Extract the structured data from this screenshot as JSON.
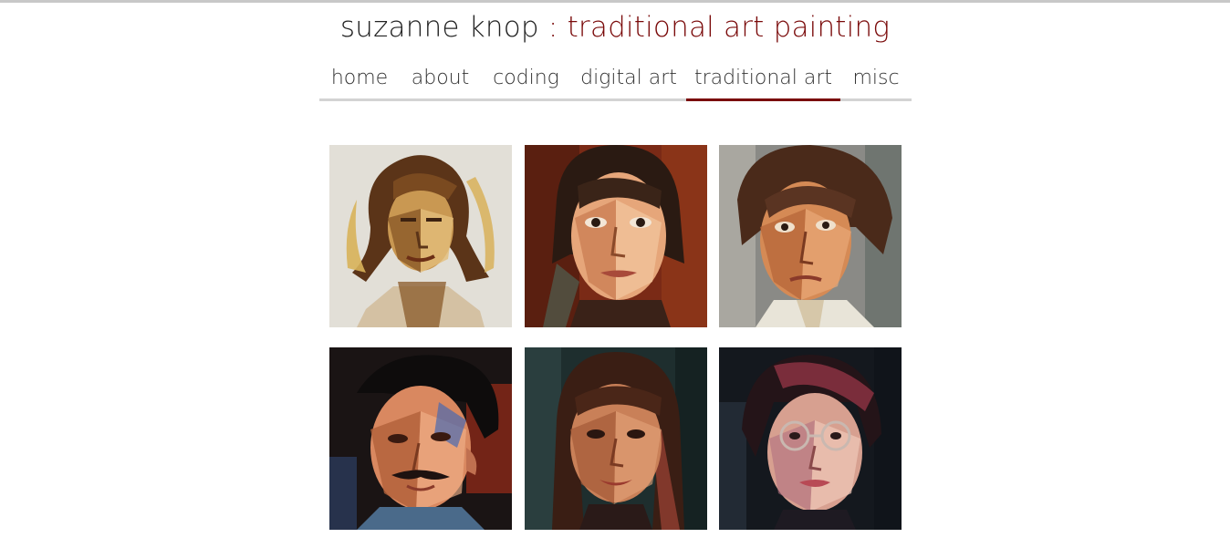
{
  "header": {
    "name": "suzanne knop",
    "separator": " : ",
    "category": "traditional art",
    "subcategory": " painting"
  },
  "nav": {
    "items": [
      {
        "label": "home"
      },
      {
        "label": "about"
      },
      {
        "label": "coding"
      },
      {
        "label": "digital art"
      },
      {
        "label": "traditional art",
        "active": true
      },
      {
        "label": "misc"
      }
    ]
  },
  "colors": {
    "accent": "#7a0a0a",
    "nav_border": "#d3d3d3",
    "text": "#222222"
  },
  "gallery": {
    "paintings": [
      {
        "icon": "portrait-painting-ochre-woman"
      },
      {
        "icon": "portrait-painting-woman-red-background"
      },
      {
        "icon": "portrait-painting-older-woman"
      },
      {
        "icon": "portrait-painting-man-mustache"
      },
      {
        "icon": "portrait-painting-woman-long-hair"
      },
      {
        "icon": "portrait-painting-woman-glasses"
      }
    ]
  }
}
